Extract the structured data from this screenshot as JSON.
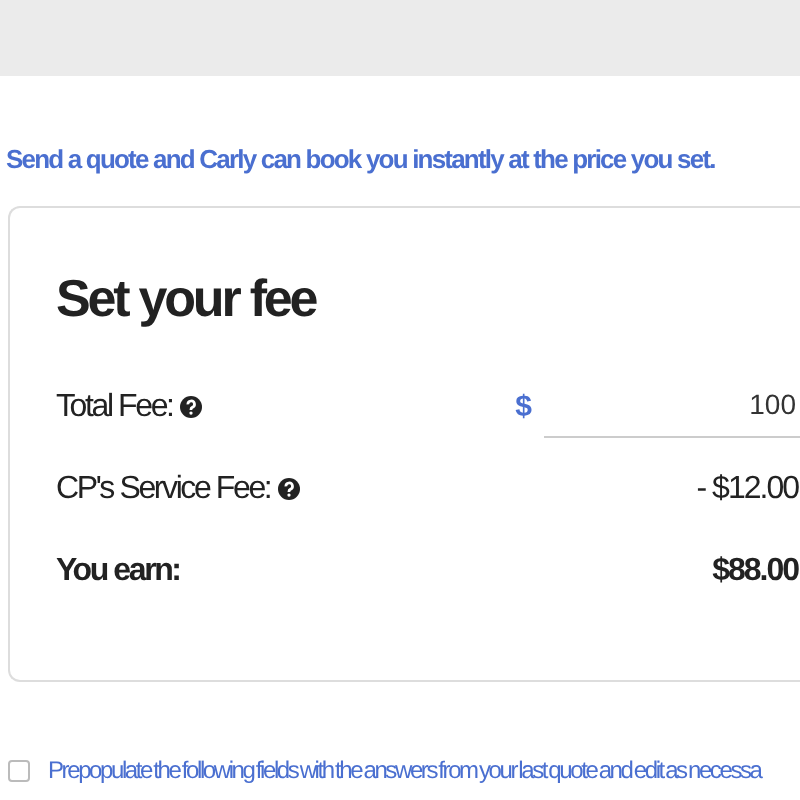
{
  "intro": "Send a quote and Carly can book you instantly at the price you set.",
  "fee_card": {
    "title": "Set your fee",
    "rows": [
      {
        "kind": "input",
        "label": "Total Fee:",
        "help": true,
        "currency": "$",
        "value": "100"
      },
      {
        "kind": "text",
        "label": "CP's Service Fee:",
        "help": true,
        "value": "- $12.00"
      },
      {
        "kind": "total",
        "label": "You earn:",
        "help": false,
        "value": "$88.00"
      }
    ]
  },
  "prepopulate": {
    "label": "Prepopulate the following fields with the answers from your last quote and edit as necessa",
    "checked": false
  }
}
